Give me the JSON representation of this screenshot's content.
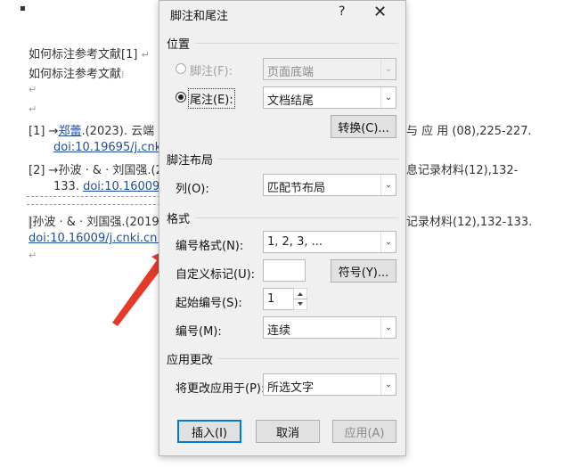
{
  "document": {
    "lines": [
      "如何标注参考文献[1]",
      "如何标注参考文献",
      "[1] →",
      "郑蕾",
      ".(2023). 云端",
      "doi:10.19695/j.cnki.c",
      "[2] →孙波 · & · 刘国强.(20",
      "133.",
      "doi:10.16009/j.",
      "孙波 · & · 刘国强.(2019).",
      "doi:10.16009/j.cnki.cn13-",
      "与 应 用 (08),225-227.",
      "息记录材料(12),132-",
      "记录材料(12),132-133."
    ],
    "para_mark": "↵"
  },
  "dialog": {
    "title": "脚注和尾注",
    "help": "?",
    "close": "✕",
    "position_section": "位置",
    "footnote_label": "脚注(F):",
    "footnote_value": "页面底端",
    "endnote_label": "尾注(E):",
    "endnote_value": "文档结尾",
    "convert_button": "转换(C)...",
    "layout_section": "脚注布局",
    "columns_label": "列(O):",
    "columns_value": "匹配节布局",
    "format_section": "格式",
    "number_format_label": "编号格式(N):",
    "number_format_value": "1, 2, 3, ...",
    "custom_mark_label": "自定义标记(U):",
    "custom_mark_value": "",
    "symbol_button": "符号(Y)...",
    "start_at_label": "起始编号(S):",
    "start_at_value": "1",
    "numbering_label": "编号(M):",
    "numbering_value": "连续",
    "apply_section": "应用更改",
    "apply_to_label": "将更改应用于(P):",
    "apply_to_value": "所选文字",
    "insert_button": "插入(I)",
    "cancel_button": "取消",
    "apply_button": "应用(A)"
  },
  "colors": {
    "accent": "#0078d7",
    "arrow": "#e53a2a"
  }
}
